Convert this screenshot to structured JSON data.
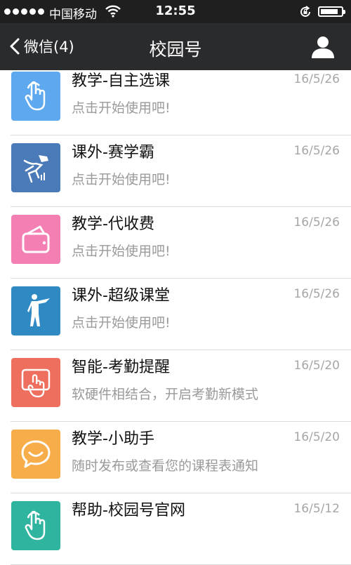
{
  "status_bar": {
    "carrier": "中国移动",
    "time": "12:55",
    "battery_level": 0.85
  },
  "nav": {
    "back_label": "微信(4)",
    "title": "校园号"
  },
  "items": [
    {
      "title": "教学-自主选课",
      "date": "16/5/26",
      "subtitle": "点击开始使用吧!",
      "icon": "hand-tap-icon",
      "color": "#5ea8f0"
    },
    {
      "title": "课外-赛学霸",
      "date": "16/5/26",
      "subtitle": "点击开始使用吧!",
      "icon": "runner-icon",
      "color": "#4a7bb8"
    },
    {
      "title": "教学-代收费",
      "date": "16/5/26",
      "subtitle": "点击开始使用吧!",
      "icon": "wallet-icon",
      "color": "#f47fb3"
    },
    {
      "title": "课外-超级课堂",
      "date": "16/5/26",
      "subtitle": "点击开始使用吧!",
      "icon": "superhero-icon",
      "color": "#2f8ac4"
    },
    {
      "title": "智能-考勤提醒",
      "date": "16/5/20",
      "subtitle": "软硬件相结合，开启考勤新模式",
      "icon": "touch-screen-icon",
      "color": "#ef6f5e"
    },
    {
      "title": "教学-小助手",
      "date": "16/5/20",
      "subtitle": "随时发布或查看您的课程表通知",
      "icon": "chat-smile-icon",
      "color": "#f6ad4a"
    },
    {
      "title": "帮助-校园号官网",
      "date": "16/5/12",
      "subtitle": "",
      "icon": "hand-tap-icon",
      "color": "#2fb4a0"
    }
  ]
}
